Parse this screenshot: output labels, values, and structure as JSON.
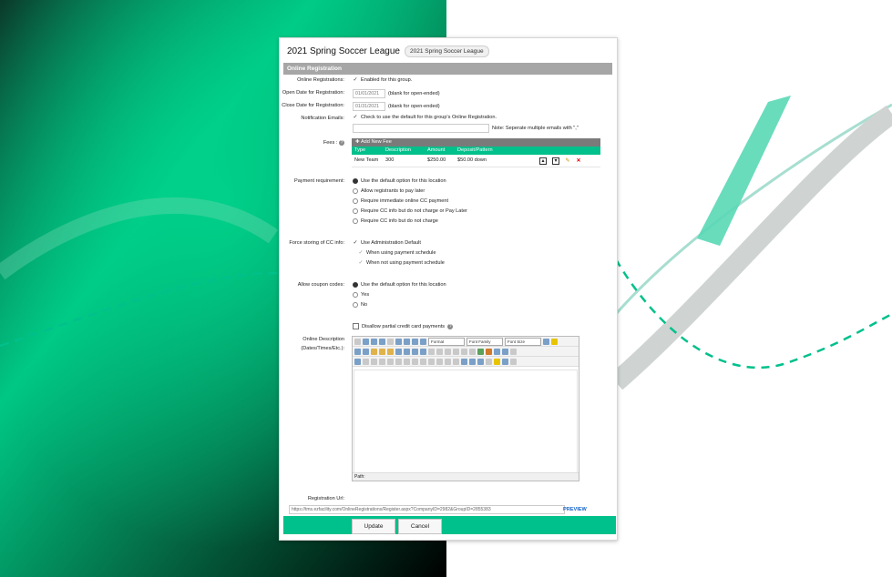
{
  "colors": {
    "accent": "#00c08b",
    "section": "#a6a6a6",
    "link": "#1463c8"
  },
  "header": {
    "title": "2021 Spring Soccer League",
    "chip": "2021 Spring Soccer League"
  },
  "section": {
    "title": "Online Registration"
  },
  "online_reg": {
    "label": "Online Registrations:",
    "text": "Enabled for this group."
  },
  "open_date": {
    "label": "Open Date for Registration:",
    "value": "01/01/2021",
    "hint": "(blank for open-ended)"
  },
  "close_date": {
    "label": "Close Date for Registration:",
    "value": "01/31/2021",
    "hint": "(blank for open-ended)"
  },
  "notify": {
    "label": "Notification Emails:",
    "text": "Check to use the default for this group's Online Registration.",
    "note": "Note: Seperate multiple emails with \",\""
  },
  "fees": {
    "label": "Fees :",
    "add_label": "Add New Fee",
    "columns": [
      "Type",
      "Description",
      "Amount",
      "Deposit/Pattern"
    ],
    "rows": [
      {
        "type": "New Team",
        "description": "300",
        "amount": "$250.00",
        "deposit": "$50.00 down"
      }
    ]
  },
  "payment": {
    "label": "Payment requirement:",
    "options": [
      "Use the default option for this location",
      "Allow registrants to pay later",
      "Require immediate online CC payment",
      "Require CC info but do not charge or Pay Later",
      "Require CC info but do not charge"
    ]
  },
  "cc_storage": {
    "label": "Force storing of CC info:",
    "options": [
      "Use Administration Default",
      "When using payment schedule",
      "When not using payment schedule"
    ]
  },
  "coupon": {
    "label": "Allow coupon codes:",
    "options": [
      "Use the default option for this location",
      "Yes",
      "No"
    ]
  },
  "partial": {
    "text": "Disallow partial credit card payments"
  },
  "description": {
    "label1": "Online Description",
    "label2": "(Dates/Times/Etc.):",
    "format": "Format",
    "font_family": "Font Family",
    "font_size": "Font Size",
    "path": "Path:"
  },
  "reg_url": {
    "label": "Registration Url:",
    "value": "https://tms.ezfacility.com/OnlineRegistrations/Register.aspx?CompanyID=2982&GroupID=2855383",
    "preview": "PREVIEW"
  },
  "footer": {
    "update": "Update",
    "cancel": "Cancel"
  }
}
